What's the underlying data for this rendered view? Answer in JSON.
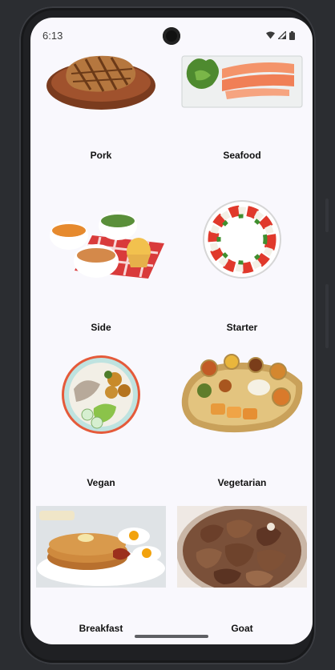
{
  "status": {
    "time": "6:13"
  },
  "categories": [
    {
      "label": "Pork",
      "image": "grilled pork chop on wooden board"
    },
    {
      "label": "Seafood",
      "image": "smoked salmon slices with salad"
    },
    {
      "label": "Side",
      "image": "bowls of side dishes with muffin"
    },
    {
      "label": "Starter",
      "image": "caprese tomato mozzarella plate"
    },
    {
      "label": "Vegan",
      "image": "vegan bowl with vegetables"
    },
    {
      "label": "Vegetarian",
      "image": "vegetarian thali platter"
    },
    {
      "label": "Breakfast",
      "image": "pancakes with eggs and bacon"
    },
    {
      "label": "Goat",
      "image": "bowl of goat stew"
    }
  ]
}
